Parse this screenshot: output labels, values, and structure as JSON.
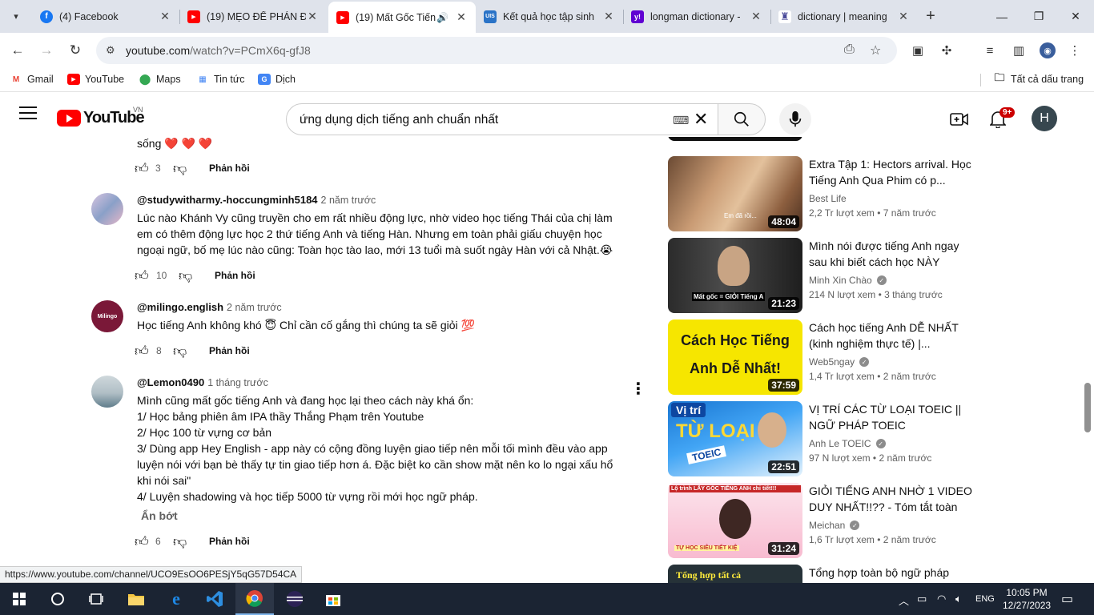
{
  "browser": {
    "tabs": [
      {
        "title": "(4) Facebook",
        "fav": "f",
        "fav_color": "#1877f2"
      },
      {
        "title": "(19) MẸO ĐỂ PHÁN Đ",
        "fav": "▶",
        "fav_color": "#ff0000"
      },
      {
        "title": "(19) Mất Gốc Tiến",
        "fav": "▶",
        "fav_color": "#ff0000",
        "active": true
      },
      {
        "title": "Kết quả học tập sinh",
        "fav": "U",
        "fav_color": "#2a73c7"
      },
      {
        "title": "longman dictionary -",
        "fav": "y!",
        "fav_color": "#6001d2"
      },
      {
        "title": "dictionary | meaning",
        "fav": "♜",
        "fav_color": "#4a4a9a"
      }
    ],
    "url_host": "youtube.com",
    "url_path": "/watch?v=PCmX6q-gfJ8",
    "bookmarks": [
      "Gmail",
      "YouTube",
      "Maps",
      "Tin tức",
      "Dịch"
    ],
    "all_bookmarks": "Tất cả dấu trang"
  },
  "youtube": {
    "logo_text": "YouTube",
    "country": "VN",
    "search_query": "ứng dụng dịch tiếng anh chuẩn nhất",
    "notif_count": "9+",
    "avatar_letter": "H"
  },
  "comments": {
    "partial_text": "sống ❤️ ❤️ ❤️",
    "partial_likes": "3",
    "reply_label": "Phản hồi",
    "show_less": "Ẩn bớt",
    "items": [
      {
        "author": "@studywitharmy.-hoccungminh5184",
        "time": "2 năm trước",
        "lines": [
          "Lúc nào Khánh Vy cũng truyền cho em rất nhiều động lực, nhờ video học tiếng Thái của chị làm",
          "em có thêm động lực học 2 thứ tiếng Anh và tiếng Hàn. Nhưng em toàn phải giấu chuyện học",
          "ngoại ngữ, bố mẹ lúc nào cũng: Toàn học tào lao, mới 13 tuổi mà suốt ngày Hàn với cả Nhật.😭"
        ],
        "likes": "10"
      },
      {
        "author": "@milingo.english",
        "time": "2 năm trước",
        "lines": [
          "Học tiếng Anh không khó 😇  Chỉ cần cố gắng thì chúng ta sẽ giỏi 💯"
        ],
        "likes": "8",
        "avatar_text": "Milingo"
      },
      {
        "author": "@Lemon0490",
        "time": "1 tháng trước",
        "lines": [
          "Mình cũng mất gốc tiếng Anh và đang học lại theo cách này khá ổn:",
          "1/ Học bảng phiên âm IPA thầy Thắng Phạm trên Youtube",
          "2/ Học 100 từ vựng cơ bản",
          "3/ Dùng app Hey English - app này có cộng đồng luyện giao tiếp nên mỗi tối mình đều vào app",
          "luyện nói với bạn bè thấy tự tin giao tiếp hơn á. Đặc biệt ko cần show mặt nên ko lo ngại xấu hổ",
          "khi nói sai\"",
          "4/ Luyện shadowing và học tiếp 5000 từ vựng rồi mới học ngữ pháp."
        ],
        "likes": "6"
      }
    ]
  },
  "related": [
    {
      "title": "Extra Tập 1: Hectors arrival. Học Tiếng Anh Qua Phim có p...",
      "channel": "Best Life",
      "verified": false,
      "views": "2,2 Tr lượt xem",
      "age": "7 năm trước",
      "duration": "48:04",
      "thumb_caption": "Em đã rồi..."
    },
    {
      "title": "Mình nói được tiếng Anh ngay sau khi biết cách học NÀY",
      "channel": "Minh Xin Chào",
      "verified": true,
      "views": "214 N lượt xem",
      "age": "3 tháng trước",
      "duration": "21:23",
      "thumb_caption": "Mất gốc = GIỎI Tiếng A"
    },
    {
      "title": "Cách học tiếng Anh DỄ NHẤT (kinh nghiệm thực tế) |...",
      "channel": "Web5ngay",
      "verified": true,
      "views": "1,4 Tr lượt xem",
      "age": "2 năm trước",
      "duration": "37:59",
      "thumb_line1": "Cách Học Tiếng",
      "thumb_line2": "Anh Dễ Nhất!"
    },
    {
      "title": "VỊ TRÍ CÁC TỪ LOẠI TOEIC || NGỮ PHÁP TOEIC",
      "channel": "Anh Le TOEIC",
      "verified": true,
      "views": "97 N lượt xem",
      "age": "2 năm trước",
      "duration": "22:51",
      "thumb_line1": "Vị trí",
      "thumb_line2": "TỪ LOẠI",
      "thumb_line3": "TOEIC"
    },
    {
      "title": "GIỎI TIẾNG ANH NHỜ 1 VIDEO DUY NHẤT!!?? - Tóm tắt toàn b...",
      "channel": "Meichan",
      "verified": true,
      "views": "1,6 Tr lượt xem",
      "age": "2 năm trước",
      "duration": "31:24",
      "thumb_line1": "Lộ trình LẤY GỐC TIẾNG ANH chi tiết!!!",
      "thumb_line2": "TỰ HỌC SIÊU TIẾT KIỆ"
    },
    {
      "title": "Tổng hợp toàn bộ ngữ pháp",
      "channel": "",
      "verified": false,
      "views": "",
      "age": "",
      "duration": "",
      "thumb_line1": "Tổng hợp tất cả"
    }
  ],
  "status_url": "https://www.youtube.com/channel/UCO9EsOO6PESjY5qG57D54CA",
  "taskbar": {
    "lang": "ENG",
    "time": "10:05 PM",
    "date": "12/27/2023"
  }
}
